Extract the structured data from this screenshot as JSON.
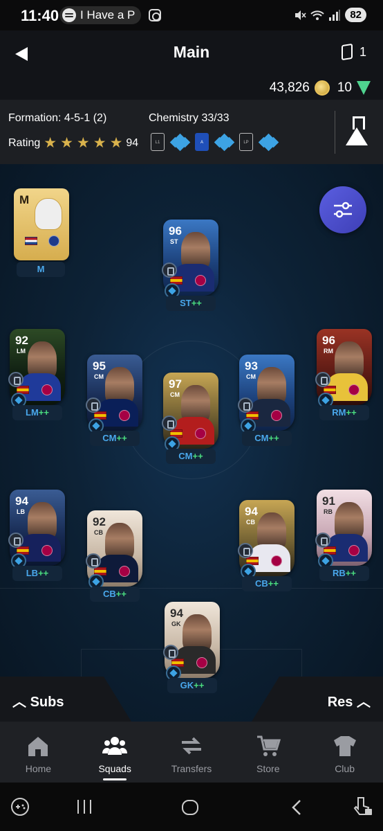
{
  "status_bar": {
    "time": "11:40",
    "media_text": "I Have a P",
    "battery": "82"
  },
  "header": {
    "title": "Main",
    "squad_count": "1",
    "coins": "43,826",
    "points": "10"
  },
  "squad_info": {
    "formation": "Formation: 4-5-1 (2)",
    "chemistry": "Chemistry 33/33",
    "rating_label": "Rating",
    "stars": 5,
    "rating_value": "94",
    "league_chem": [
      {
        "league": "Ligue 1"
      },
      {
        "league": "Serie A"
      },
      {
        "league": "Liga Portugal"
      }
    ]
  },
  "manager": {
    "label": "M",
    "position_label": "M",
    "flag": "netherlands",
    "club": "nwsl"
  },
  "players": [
    {
      "id": "st",
      "rating": "96",
      "pos": "ST",
      "label_main": "ST",
      "label_plus": "++",
      "card_style": "blue"
    },
    {
      "id": "lm",
      "rating": "92",
      "pos": "LM",
      "label_main": "LM",
      "label_plus": "++",
      "card_style": "green"
    },
    {
      "id": "lcm",
      "rating": "95",
      "pos": "CM",
      "label_main": "CM",
      "label_plus": "++",
      "card_style": "navy"
    },
    {
      "id": "cm",
      "rating": "97",
      "pos": "CM",
      "label_main": "CM",
      "label_plus": "++",
      "card_style": "gold"
    },
    {
      "id": "rcm",
      "rating": "93",
      "pos": "CM",
      "label_main": "CM",
      "label_plus": "++",
      "card_style": "blue"
    },
    {
      "id": "rm",
      "rating": "96",
      "pos": "RM",
      "label_main": "RM",
      "label_plus": "++",
      "card_style": "red"
    },
    {
      "id": "lb",
      "rating": "94",
      "pos": "LB",
      "label_main": "LB",
      "label_plus": "++",
      "card_style": "navy"
    },
    {
      "id": "lcb",
      "rating": "92",
      "pos": "CB",
      "label_main": "CB",
      "label_plus": "++",
      "card_style": "cream"
    },
    {
      "id": "rcb",
      "rating": "94",
      "pos": "CB",
      "label_main": "CB",
      "label_plus": "++",
      "card_style": "gold"
    },
    {
      "id": "rb",
      "rating": "91",
      "pos": "RB",
      "label_main": "RB",
      "label_plus": "++",
      "card_style": "pink"
    },
    {
      "id": "gk",
      "rating": "94",
      "pos": "GK",
      "label_main": "GK",
      "label_plus": "++",
      "card_style": "cream"
    }
  ],
  "bench": {
    "subs_label": "Subs",
    "res_label": "Res"
  },
  "bottom_nav": [
    {
      "label": "Home",
      "icon": "home-icon",
      "active": false
    },
    {
      "label": "Squads",
      "icon": "people-icon",
      "active": true
    },
    {
      "label": "Transfers",
      "icon": "arrows-icon",
      "active": false
    },
    {
      "label": "Store",
      "icon": "cart-icon",
      "active": false
    },
    {
      "label": "Club",
      "icon": "jersey-icon",
      "active": false
    }
  ],
  "colors": {
    "accent_plus": "#4ade80",
    "accent_blue": "#4aa8ec",
    "fab": "#5052d0",
    "gold_star": "#d9b24c"
  }
}
